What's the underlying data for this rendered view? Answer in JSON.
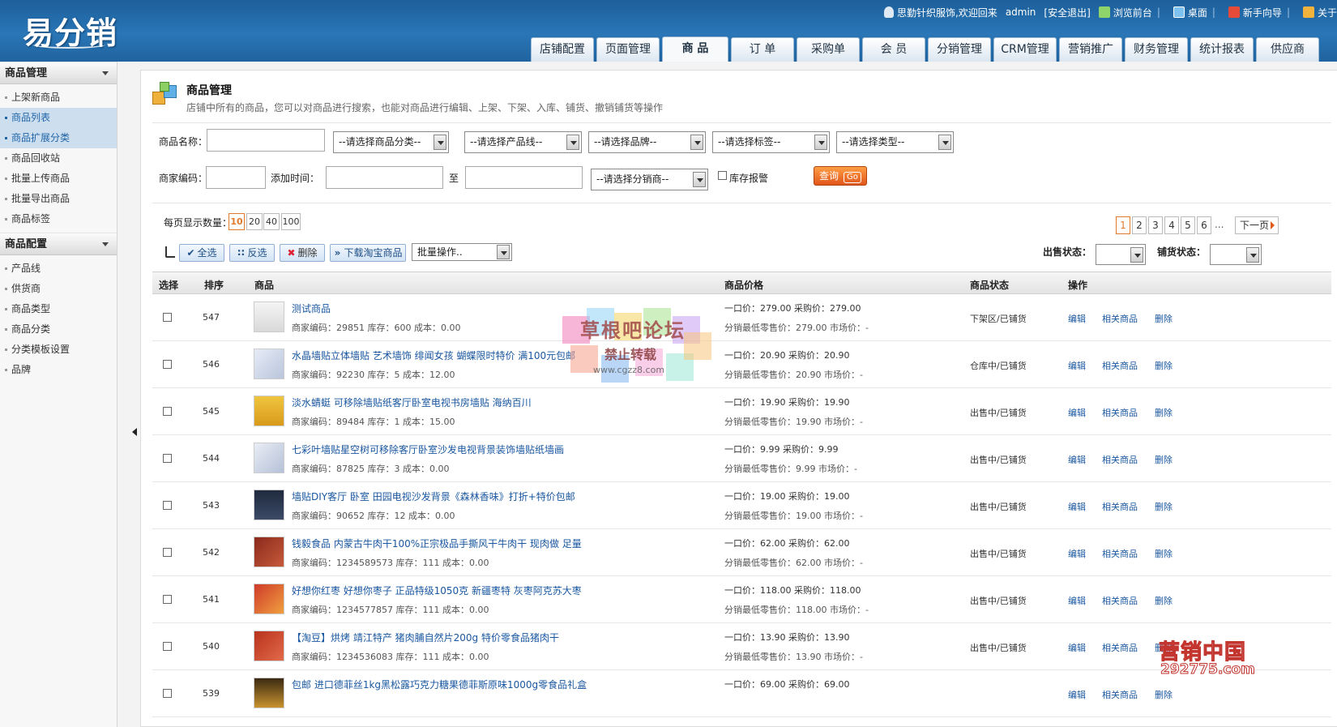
{
  "app": {
    "logo": "易分销"
  },
  "topinfo": {
    "welcome": "思勤针织服饰,欢迎回来",
    "user": "admin",
    "logout": "[安全退出]",
    "front": "浏览前台",
    "desktop": "桌面",
    "guide": "新手向导",
    "about": "关于"
  },
  "nav": {
    "tabs": [
      "店铺配置",
      "页面管理",
      "商 品",
      "订 单",
      "采购单",
      "会 员",
      "分销管理",
      "CRM管理",
      "营销推广",
      "财务管理",
      "统计报表",
      "供应商"
    ],
    "active": 2
  },
  "sidebar": {
    "group1": {
      "title": "商品管理",
      "items": [
        "上架新商品",
        "商品列表",
        "商品扩展分类",
        "商品回收站",
        "批量上传商品",
        "批量导出商品",
        "商品标签"
      ]
    },
    "group2": {
      "title": "商品配置",
      "items": [
        "产品线",
        "供货商",
        "商品类型",
        "商品分类",
        "分类模板设置",
        "品牌"
      ]
    }
  },
  "header": {
    "title": "商品管理",
    "desc": "店铺中所有的商品，您可以对商品进行搜索，也能对商品进行编辑、上架、下架、入库、铺货、撤销铺货等操作"
  },
  "filter": {
    "name_label": "商品名称：",
    "category": "--请选择商品分类--",
    "line": "--请选择产品线--",
    "brand": "--请选择品牌--",
    "tag": "--请选择标签--",
    "type": "--请选择类型--",
    "code_label": "商家编码：",
    "time_label": "添加时间：",
    "to": "至",
    "distributor": "--请选择分销商--",
    "stock_alert": "库存报警",
    "search": "查询",
    "go": "Go"
  },
  "toolbar": {
    "page_size_label": "每页显示数量：",
    "page_sizes": [
      "10",
      "20",
      "40",
      "100"
    ],
    "pages": [
      "1",
      "2",
      "3",
      "4",
      "5",
      "6"
    ],
    "ellipsis": "...",
    "next": "下一页",
    "select_all": "全选",
    "invert": "反选",
    "delete": "删除",
    "download_taobao": "下载淘宝商品",
    "batch": "批量操作..",
    "sale_status_label": "出售状态：",
    "distribute_status_label": "铺货状态："
  },
  "table": {
    "headers": [
      "选择",
      "排序",
      "商品",
      "商品价格",
      "商品状态",
      "操作"
    ],
    "actions": [
      "编辑",
      "相关商品",
      "删除"
    ],
    "rows": [
      {
        "sort": "547",
        "name": "测试商品",
        "meta": "商家编码：29851  库存：600  成本：0.00",
        "price1": "一口价：279.00  采购价：279.00",
        "price2": "分销最低零售价：279.00  市场价：-",
        "status": "下架区/已铺货"
      },
      {
        "sort": "546",
        "name": "水晶墙贴立体墙贴 艺术墙饰 绯闻女孩 蝴蝶限时特价 满100元包邮",
        "meta": "商家编码：92230  库存：5  成本：12.00",
        "price1": "一口价：20.90  采购价：20.90",
        "price2": "分销最低零售价：20.90  市场价：-",
        "status": "仓库中/已铺货"
      },
      {
        "sort": "545",
        "name": "淡水蜻蜓 可移除墙贴纸客厅卧室电视书房墙贴 海纳百川",
        "meta": "商家编码：89484  库存：1  成本：15.00",
        "price1": "一口价：19.90  采购价：19.90",
        "price2": "分销最低零售价：19.90  市场价：-",
        "status": "出售中/已铺货"
      },
      {
        "sort": "544",
        "name": "七彩叶墙贴星空树可移除客厅卧室沙发电视背景装饰墙贴纸墙画",
        "meta": "商家编码：87825  库存：3  成本：0.00",
        "price1": "一口价：9.99  采购价：9.99",
        "price2": "分销最低零售价：9.99  市场价：-",
        "status": "出售中/已铺货"
      },
      {
        "sort": "543",
        "name": "墙贴DIY客厅 卧室 田园电视沙发背景《森林香味》打折+特价包邮",
        "meta": "商家编码：90652  库存：12  成本：0.00",
        "price1": "一口价：19.00  采购价：19.00",
        "price2": "分销最低零售价：19.00  市场价：-",
        "status": "出售中/已铺货"
      },
      {
        "sort": "542",
        "name": "钱毅食品 内蒙古牛肉干100%正宗极品手撕风干牛肉干 现肉做 足量",
        "meta": "商家编码：1234589573  库存：111  成本：0.00",
        "price1": "一口价：62.00  采购价：62.00",
        "price2": "分销最低零售价：62.00  市场价：-",
        "status": "出售中/已铺货"
      },
      {
        "sort": "541",
        "name": "好想你红枣 好想你枣子 正品特级1050克 新疆枣特 灰枣阿克苏大枣",
        "meta": "商家编码：1234577857  库存：111  成本：0.00",
        "price1": "一口价：118.00  采购价：118.00",
        "price2": "分销最低零售价：118.00  市场价：-",
        "status": "出售中/已铺货"
      },
      {
        "sort": "540",
        "name": "【淘豆】烘烤 靖江特产 猪肉脯自然片200g 特价零食品猪肉干",
        "meta": "商家编码：1234536083  库存：111  成本：0.00",
        "price1": "一口价：13.90  采购价：13.90",
        "price2": "分销最低零售价：13.90  市场价：-",
        "status": "出售中/已铺货"
      },
      {
        "sort": "539",
        "name": "包邮 进口德菲丝1kg黑松露巧克力糖果德菲斯原味1000g零食品礼盒",
        "meta": "",
        "price1": "一口价：69.00  采购价：69.00",
        "price2": "",
        "status": ""
      }
    ]
  },
  "watermarks": {
    "w1a": "草根吧论坛",
    "w1b": "禁止转载",
    "w1c": "www.cgzz8.com",
    "w2a": "营销中国",
    "w2b": "292775.com"
  },
  "colors": {
    "topbar": "#2a76b6",
    "link": "#1a57a0",
    "accent": "#e07a2d",
    "selected_bg": "#cddfef"
  }
}
